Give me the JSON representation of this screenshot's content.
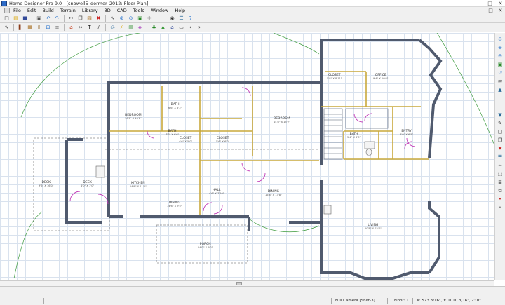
{
  "window": {
    "title": "Home Designer Pro 9.0 - [snowell5_dormer_2012: Floor Plan]",
    "minimize": "–",
    "maximize": "□",
    "close": "✕"
  },
  "menu": {
    "items": [
      "File",
      "Edit",
      "Build",
      "Terrain",
      "Library",
      "3D",
      "CAD",
      "Tools",
      "Window",
      "Help"
    ]
  },
  "toolbar": {
    "row1_icons": [
      "new-file-icon",
      "open-folder-icon",
      "save-icon",
      "print-icon",
      "undo-icon",
      "redo-icon",
      "cut-icon",
      "copy-icon",
      "paste-icon",
      "delete-icon",
      "select-objects-icon",
      "zoom-in-icon",
      "zoom-out-icon",
      "fill-window-icon",
      "pan-icon",
      "ruler-icon",
      "camera-icon",
      "layer-icon",
      "help-icon"
    ],
    "row2_icons": [
      "select-icon",
      "wall-icon",
      "cabinet-icon",
      "door-icon",
      "window-icon",
      "stairs-icon",
      "roof-icon",
      "dimension-icon",
      "text-icon",
      "cad-line-icon",
      "fixture-icon",
      "electrical-icon",
      "library-icon",
      "material-icon",
      "plant-icon",
      "terrain-icon",
      "home-icon",
      "view-icon"
    ],
    "nav_up": "‹",
    "nav_down": "›"
  },
  "side_toolbar": {
    "icons": [
      "zoom-icon",
      "zoom-in-icon",
      "zoom-out-icon",
      "fill-window-icon",
      "undo-zoom-icon",
      "swap-view-icon",
      "floor-up-icon",
      "floor-down-icon",
      "edit-icon",
      "open-object-icon",
      "copy-icon",
      "delete-icon",
      "layer-icon",
      "mirror-icon",
      "transform-icon",
      "align-icon",
      "group-icon",
      "point-icon",
      "spacer-icon"
    ]
  },
  "rooms": [
    {
      "name": "BEDROOM",
      "dim": "10'6\" X 13'8\""
    },
    {
      "name": "BATH",
      "dim": "6'6\" X 8'3\""
    },
    {
      "name": "BATH",
      "dim": "7'6\" X 6'6\""
    },
    {
      "name": "BATH",
      "dim": "5'4\" X 6'0\""
    },
    {
      "name": "CLOSET",
      "dim": "4'6\" X 5'0\""
    },
    {
      "name": "CLOSET",
      "dim": "5'6\" X 6'0\""
    },
    {
      "name": "BEDROOM",
      "dim": "14'8\" X 15'2\""
    },
    {
      "name": "CLOSET",
      "dim": "5'8\" X 8'11\""
    },
    {
      "name": "OFFICE",
      "dim": "9'4\" X 10'6\""
    },
    {
      "name": "ENTRY",
      "dim": "8'0\" X 6'5\""
    },
    {
      "name": "KITCHEN",
      "dim": "14'6\" X 11'6\""
    },
    {
      "name": "DINING",
      "dim": "14'6\" X 9'5\""
    },
    {
      "name": "HALL",
      "dim": "4'6\" X 7'10\""
    },
    {
      "name": "DINING",
      "dim": "16'6\" X 13'8\""
    },
    {
      "name": "LIVING",
      "dim": "20'8\" X 22'7\""
    },
    {
      "name": "PORCH",
      "dim": "14'0\" X 9'2\""
    },
    {
      "name": "DECK",
      "dim": "9'6\" X 16'0\""
    },
    {
      "name": "DECK",
      "dim": "4'0\" X 7'0\""
    }
  ],
  "status": {
    "camera": "Full Camera [Shift-3]",
    "floor": "Floor: 1",
    "coords": "X: 573 3/16\", Y: 1010 3/16\", Z: 0\""
  },
  "colors": {
    "wall": "#505a6e",
    "wall_fill": "#c9a93c",
    "door": "#c23bb8",
    "grid": "#d9e2ee",
    "terrain": "#3c9a3c"
  }
}
